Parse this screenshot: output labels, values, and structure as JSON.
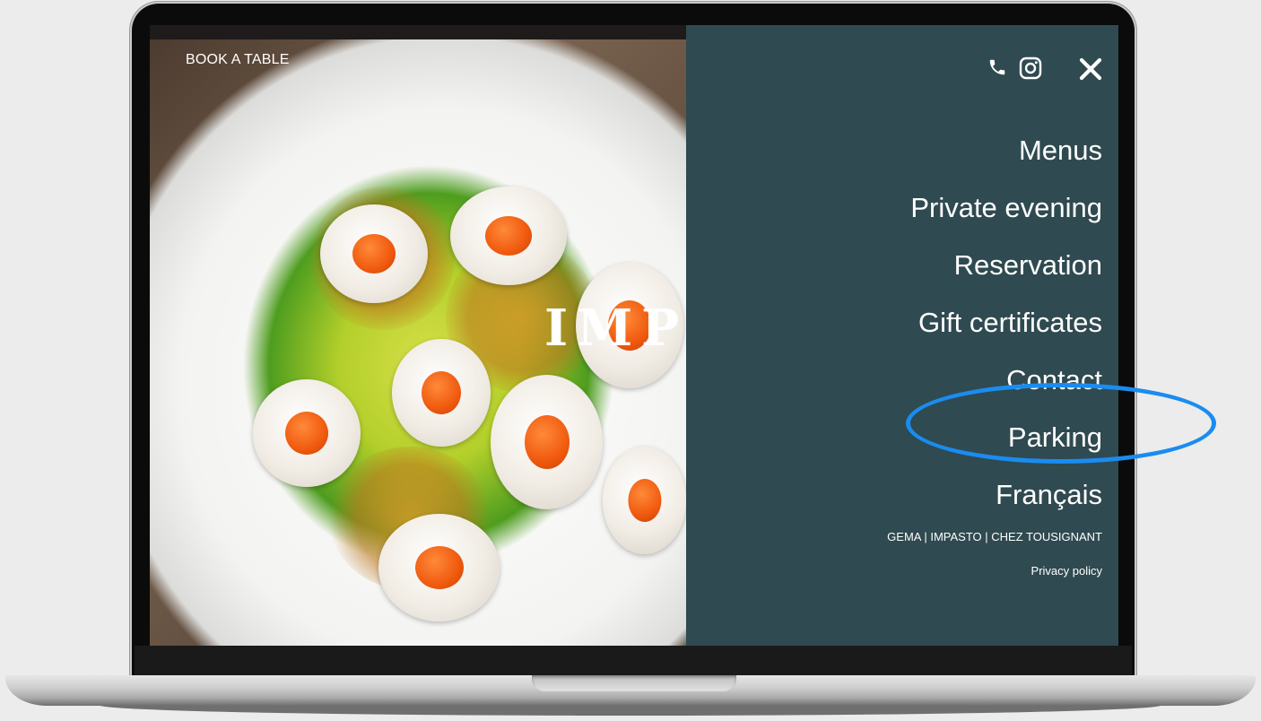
{
  "header": {
    "book_label": "BOOK A TABLE",
    "logo_text": "IMP"
  },
  "icons": [
    "phone-icon",
    "instagram-icon",
    "close-icon"
  ],
  "menu": {
    "items": [
      {
        "label": "Menus"
      },
      {
        "label": "Private evening"
      },
      {
        "label": "Reservation"
      },
      {
        "label": "Gift certificates"
      },
      {
        "label": "Contact"
      },
      {
        "label": "Parking"
      },
      {
        "label": "Français"
      }
    ]
  },
  "footer": {
    "sites": "GEMA | IMPASTO | CHEZ TOUSIGNANT",
    "privacy": "Privacy policy"
  },
  "colors": {
    "panel_bg": "#2f4a50",
    "highlight": "#1a8cf0"
  }
}
